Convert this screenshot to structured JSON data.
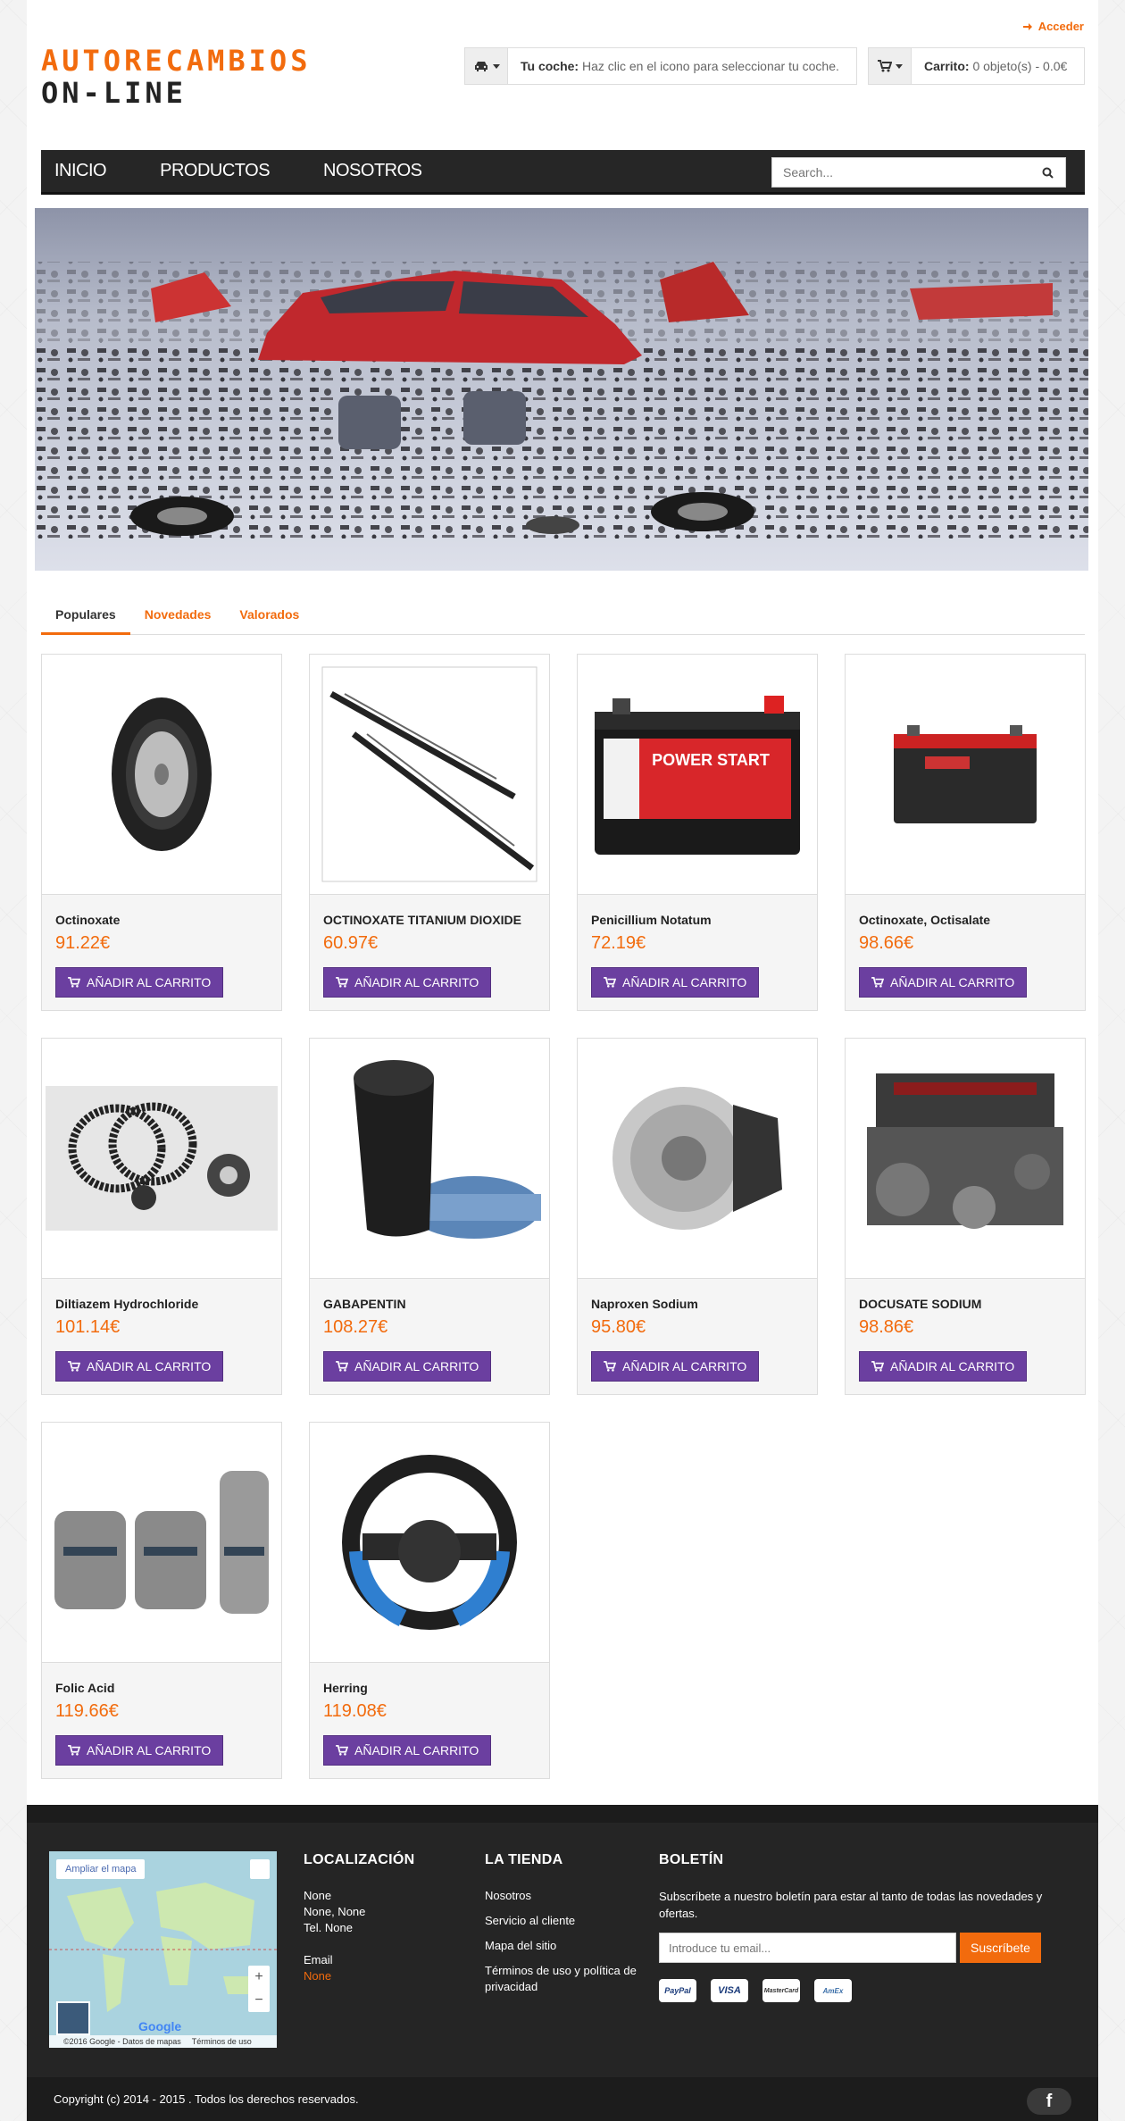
{
  "header": {
    "login_label": "Acceder",
    "logo_line1": "AUTORECAMBIOS",
    "logo_line2": "ON-LINE",
    "car_label": "Tu coche:",
    "car_text": "Haz clic en el icono para seleccionar tu coche.",
    "cart_label": "Carrito:",
    "cart_text": "0 objeto(s) - 0.0€"
  },
  "nav": {
    "items": [
      "INICIO",
      "PRODUCTOS",
      "NOSOTROS"
    ],
    "search_placeholder": "Search..."
  },
  "tabs": [
    "Populares",
    "Novedades",
    "Valorados"
  ],
  "add_to_cart_label": "AÑADIR AL CARRITO",
  "products": [
    {
      "name": "Octinoxate",
      "price": "91.22€",
      "image": "tire"
    },
    {
      "name": "OCTINOXATE TITANIUM DIOXIDE",
      "price": "60.97€",
      "image": "wipers"
    },
    {
      "name": "Penicillium Notatum",
      "price": "72.19€",
      "image": "battery-power-start"
    },
    {
      "name": "Octinoxate, Octisalate",
      "price": "98.66€",
      "image": "battery-dark"
    },
    {
      "name": "Diltiazem Hydrochloride",
      "price": "101.14€",
      "image": "timing-belt"
    },
    {
      "name": "GABAPENTIN",
      "price": "108.27€",
      "image": "gear-knob"
    },
    {
      "name": "Naproxen Sodium",
      "price": "95.80€",
      "image": "brake-disc"
    },
    {
      "name": "DOCUSATE SODIUM",
      "price": "98.86€",
      "image": "engine"
    },
    {
      "name": "Folic Acid",
      "price": "119.66€",
      "image": "pedals"
    },
    {
      "name": "Herring",
      "price": "119.08€",
      "image": "steering-wheel"
    }
  ],
  "footer": {
    "map": {
      "enlarge": "Ampliar el mapa",
      "attribution": "©2016 Google - Datos de mapas",
      "terms": "Términos de uso",
      "brand": "Google"
    },
    "location": {
      "title": "LOCALIZACIÓN",
      "line1": "None",
      "line2": "None, None",
      "line3": "Tel. None",
      "email_label": "Email",
      "email_value": "None"
    },
    "store": {
      "title": "LA TIENDA",
      "links": [
        "Nosotros",
        "Servicio al cliente",
        "Mapa del sitio",
        "Términos de uso y política de privacidad"
      ]
    },
    "newsletter": {
      "title": "BOLETÍN",
      "text": "Subscríbete a nuestro boletín para estar al tanto de todas las novedades y ofertas.",
      "placeholder": "Introduce tu email...",
      "button": "Suscríbete",
      "payments": [
        "PayPal",
        "VISA",
        "MasterCard",
        "AmEx"
      ]
    },
    "copyright": "Copyright (c) 2014 - 2015 . Todos los derechos reservados.",
    "social": "f"
  },
  "colors": {
    "accent": "#f26b0d",
    "button": "#6b3fa0",
    "nav": "#262626",
    "footer": "#252525"
  }
}
